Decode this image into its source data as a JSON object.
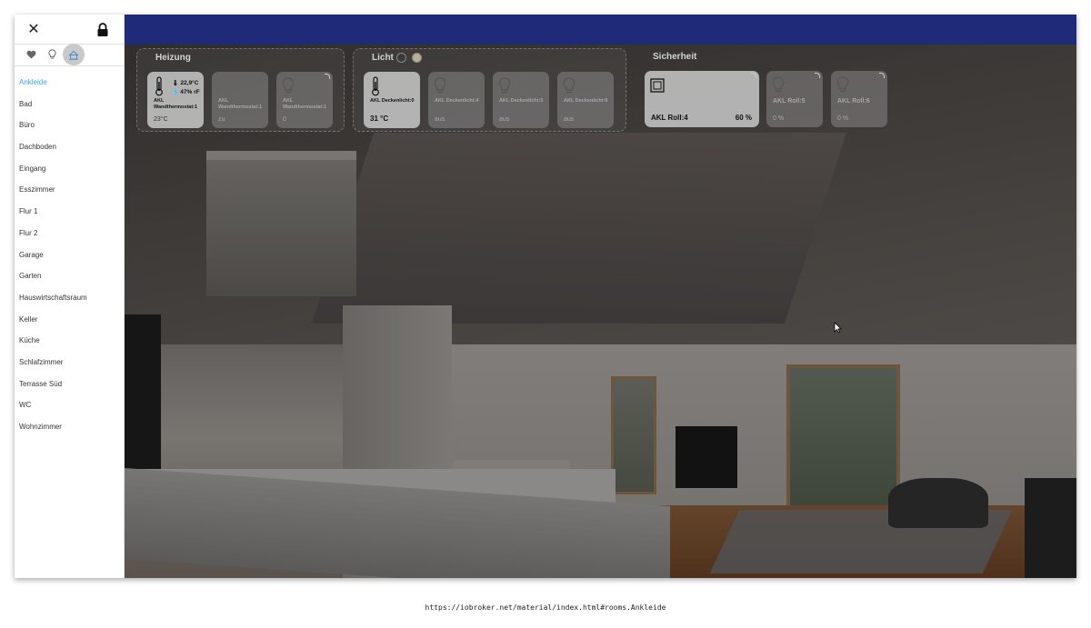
{
  "drawer": {
    "close_icon": "close-icon",
    "lock_icon": "lock-icon",
    "tabs": [
      {
        "icon": "heart-icon",
        "active": false
      },
      {
        "icon": "lightbulb-icon",
        "active": false
      },
      {
        "icon": "rooms-icon",
        "active": true
      }
    ],
    "rooms": [
      "Ankleide",
      "Bad",
      "Büro",
      "Dachboden",
      "Eingang",
      "Esszimmer",
      "Flur 1",
      "Flur 2",
      "Garage",
      "Garten",
      "Hauswirtschaftsraum",
      "Keller",
      "Küche",
      "Schlafzimmer",
      "Terrasse Süd",
      "WC",
      "Wohnzimmer"
    ],
    "active_room": "Ankleide"
  },
  "groups": {
    "heizung": {
      "title": "Heizung",
      "tiles": [
        {
          "name": "AKL Wandthermostat:1",
          "temp": "22,9°C",
          "humidity": "47% rF",
          "value": "23°C"
        },
        {
          "name": "AKL Wandthermostat:1",
          "value": "zu"
        },
        {
          "name": "AKL Wandthermostat:1",
          "value": "0"
        }
      ]
    },
    "licht": {
      "title": "Licht",
      "tiles": [
        {
          "name": "AKL Deckenlicht:0",
          "value": "31 °C"
        },
        {
          "name": "AKL Deckenlicht:4",
          "value": "aus"
        },
        {
          "name": "AKL Deckenlicht:5",
          "value": "aus"
        },
        {
          "name": "AKL Deckenlicht:6",
          "value": "aus"
        }
      ]
    },
    "sicherheit": {
      "title": "Sicherheit",
      "tiles": [
        {
          "name": "AKL Roll:4",
          "value": "60 %"
        },
        {
          "name": "AKL Roll:5",
          "value": "0 %"
        },
        {
          "name": "AKL Roll:6",
          "value": "0 %"
        }
      ]
    }
  },
  "colors": {
    "appbar": "#1f2b78",
    "active_room": "#3aa7e8"
  },
  "url": "https://iobroker.net/material/index.html#rooms.Ankleide"
}
